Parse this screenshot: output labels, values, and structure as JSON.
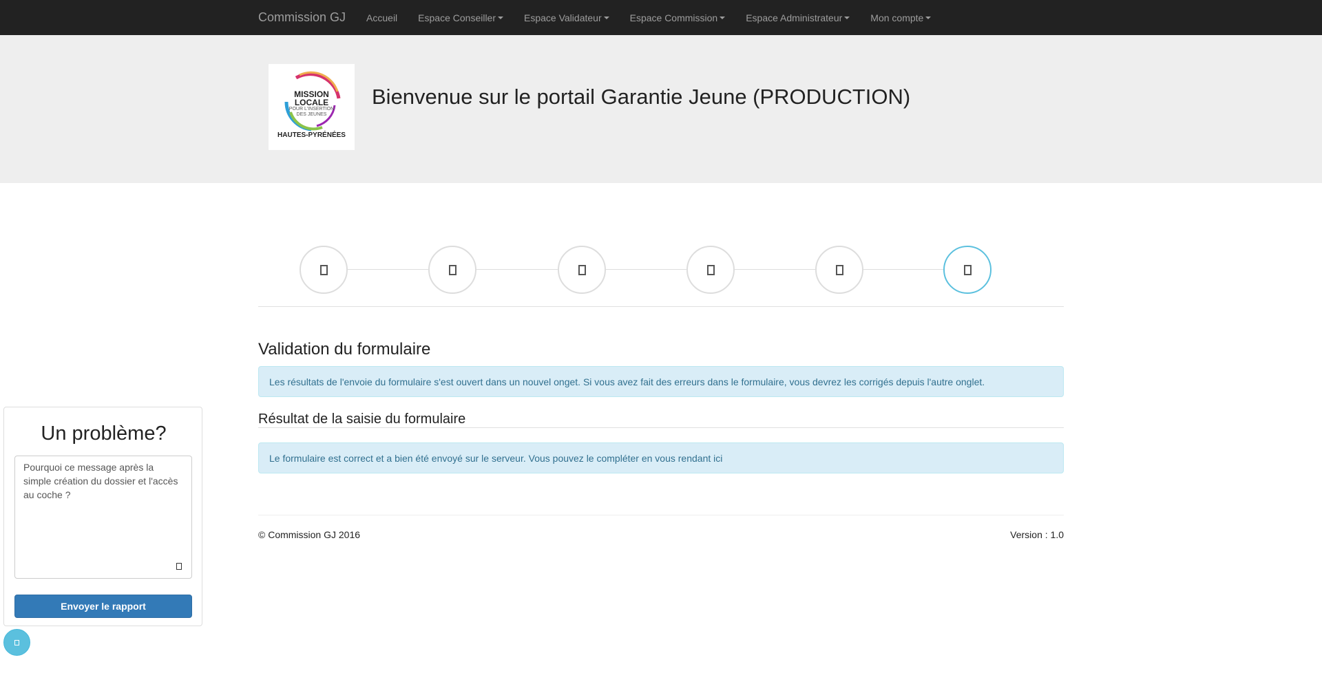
{
  "navbar": {
    "brand": "Commission GJ",
    "items": [
      {
        "label": "Accueil",
        "dropdown": false
      },
      {
        "label": "Espace Conseiller",
        "dropdown": true
      },
      {
        "label": "Espace Validateur",
        "dropdown": true
      },
      {
        "label": "Espace Commission",
        "dropdown": true
      },
      {
        "label": "Espace Administrateur",
        "dropdown": true
      },
      {
        "label": "Mon compte ",
        "dropdown": true
      }
    ]
  },
  "header": {
    "logo": {
      "title_line1": "MISSION",
      "title_line2": "LOCALE",
      "sub_line1": "POUR L'INSERTION",
      "sub_line2": "DES JEUNES",
      "region": "HAUTES-PYRÉNÉES"
    },
    "welcome": "Bienvenue sur le portail Garantie Jeune (PRODUCTION)"
  },
  "stepper": {
    "steps": [
      "step-1",
      "step-2",
      "step-3",
      "step-4",
      "step-5",
      "step-6"
    ],
    "active_index": 5,
    "active_color": "#5bc0de"
  },
  "content": {
    "validation_title": "Validation du formulaire",
    "validation_alert": "Les résultats de l'envoie du formulaire s'est ouvert dans un nouvel onget. Si vous avez fait des erreurs dans le formulaire, vous devrez les corrigés depuis l'autre onglet.",
    "result_title": "Résultat de la saisie du formulaire",
    "result_alert": "Le formulaire est correct et a bien été envoyé sur le serveur. Vous pouvez le compléter en vous rendant ici"
  },
  "footer": {
    "copyright": "© Commission GJ 2016",
    "version": "Version : 1.0"
  },
  "feedback": {
    "title": "Un problème?",
    "message": "Pourquoi ce message après la simple création du dossier et l'accès au coche ?",
    "submit_label": "Envoyer le rapport"
  },
  "colors": {
    "navbar": "#222222",
    "jumbotron": "#eeeeee",
    "alert_bg": "#d9edf7",
    "alert_text": "#31708f",
    "primary_button": "#337ab7",
    "info": "#5bc0de"
  }
}
